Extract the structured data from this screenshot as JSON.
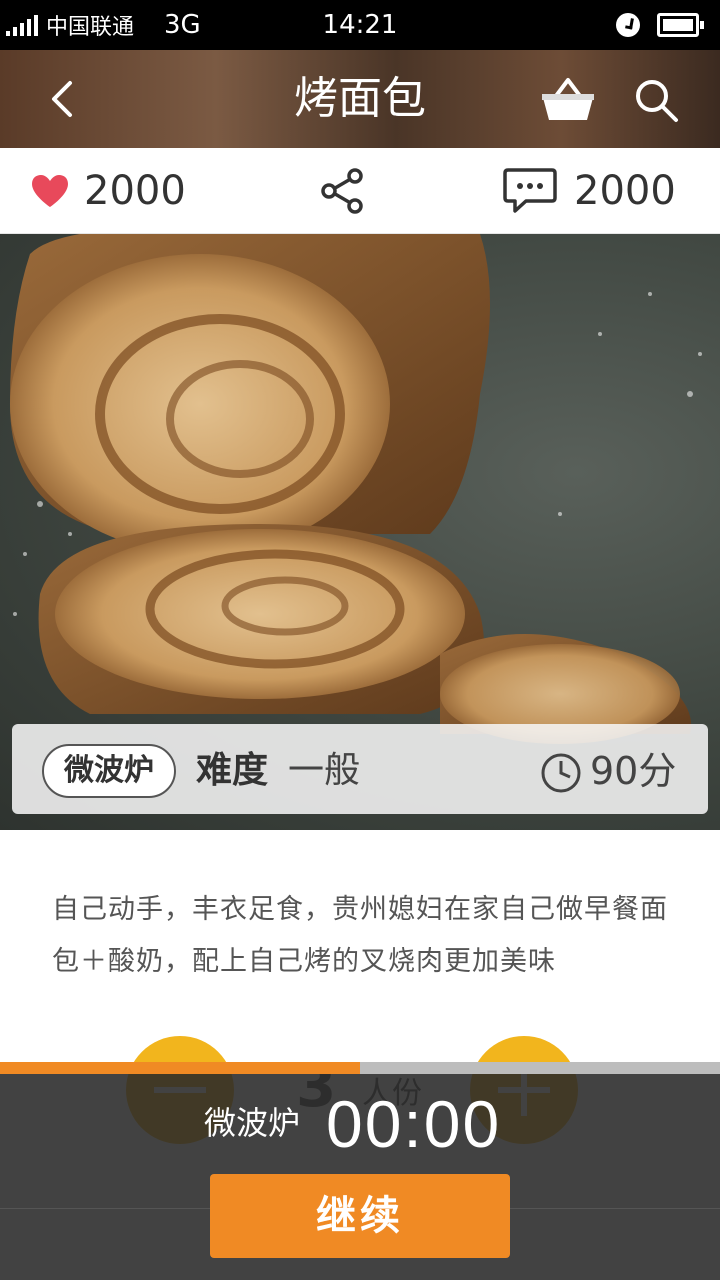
{
  "status_bar": {
    "carrier": "中国联通",
    "network": "3G",
    "time": "14:21"
  },
  "header": {
    "title": "烤面包"
  },
  "stats": {
    "likes": "2000",
    "comments": "2000"
  },
  "info": {
    "tag": "微波炉",
    "difficulty_label": "难度",
    "difficulty_value": "一般",
    "time": "90分"
  },
  "description": "自己动手，丰衣足食，贵州媳妇在家自己做早餐面包＋酸奶，配上自己烤的叉烧肉更加美味",
  "servings": {
    "count": "3",
    "unit": "人份"
  },
  "timer": {
    "mode": "微波炉",
    "time": "00:00",
    "progress": 0.5,
    "continue_label": "继续"
  },
  "colors": {
    "accent": "#f08a24",
    "serving_button": "#f2b51d",
    "heart": "#e8495b"
  }
}
